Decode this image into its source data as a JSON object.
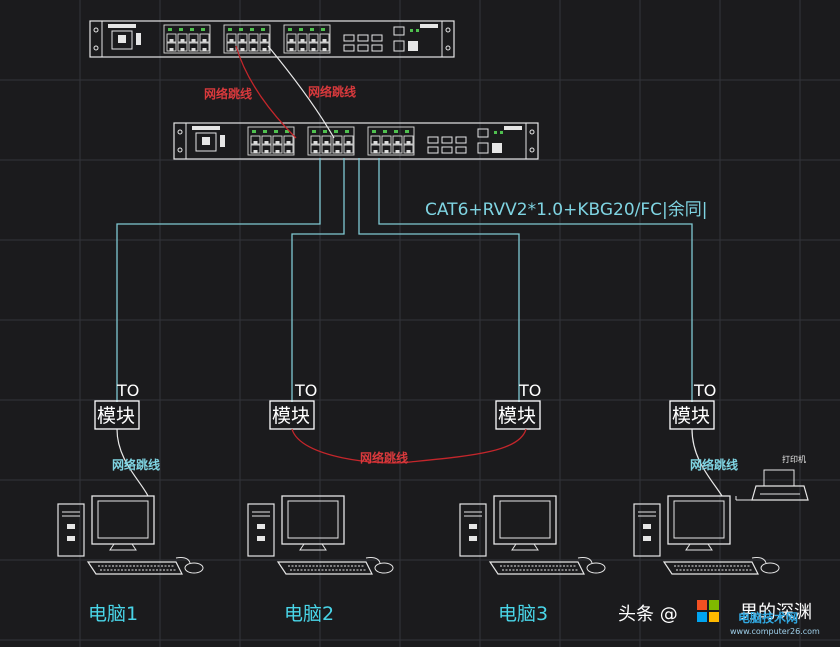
{
  "colors": {
    "background": "#1b1b1d",
    "grid": "#33343a",
    "cable_cyan": "#7fc9d3",
    "patch_red": "#c4262b",
    "pc_label": "#49d5e8"
  },
  "patch_labels": {
    "top_left": "网络跳线",
    "top_right": "网络跳线",
    "between_modules": "网络跳线",
    "pc1": "网络跳线",
    "pc4": "网络跳线"
  },
  "cable_spec": "CAT6+RVV2*1.0+KBG20/FC|余同|",
  "outlets": [
    {
      "to": "TO",
      "module": "模块"
    },
    {
      "to": "TO",
      "module": "模块"
    },
    {
      "to": "TO",
      "module": "模块"
    },
    {
      "to": "TO",
      "module": "模块"
    }
  ],
  "computers": [
    {
      "label": "电脑1"
    },
    {
      "label": "电脑2"
    },
    {
      "label": "电脑3"
    },
    {
      "label": ""
    }
  ],
  "printer_label": "打印机",
  "watermark": {
    "text": "头条 @",
    "text2": "男的深渊",
    "site_name": "电脑技术网",
    "site_url": "www.computer26.com"
  }
}
